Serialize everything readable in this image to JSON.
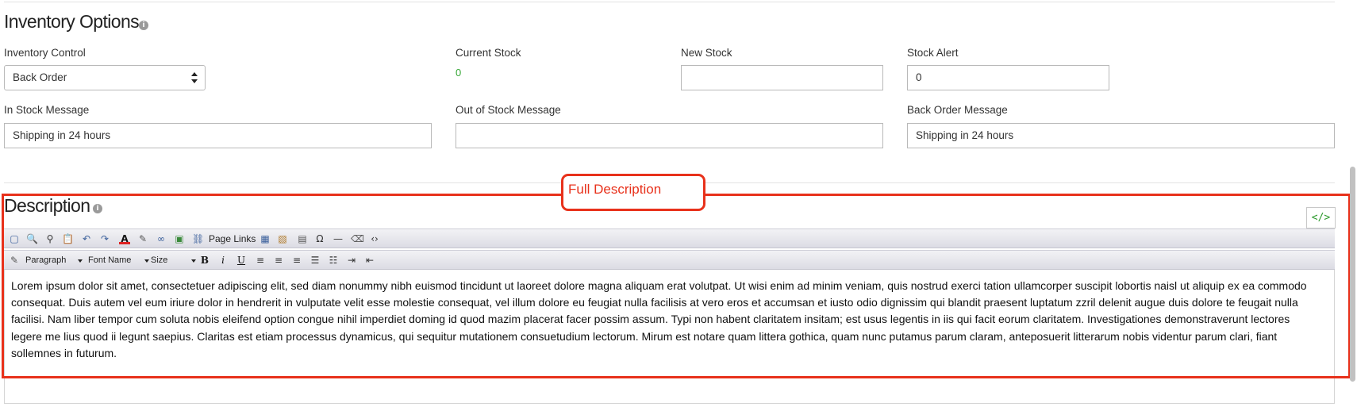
{
  "inventory": {
    "title": "Inventory Options",
    "info_icon": "info-icon",
    "inventory_control": {
      "label": "Inventory Control",
      "value": "Back Order"
    },
    "current_stock": {
      "label": "Current Stock",
      "value": "0"
    },
    "new_stock": {
      "label": "New Stock",
      "value": ""
    },
    "stock_alert": {
      "label": "Stock Alert",
      "value": "0"
    },
    "in_stock_message": {
      "label": "In Stock Message",
      "value": "Shipping in 24 hours"
    },
    "out_of_stock_message": {
      "label": "Out of Stock Message",
      "value": ""
    },
    "back_order_message": {
      "label": "Back Order Message",
      "value": "Shipping in 24 hours"
    }
  },
  "description": {
    "title": "Description",
    "info_icon": "info-icon",
    "callout_label": "Full Description",
    "callout_color": "#e8311b",
    "code_button_label": "</>",
    "toolbar1": {
      "icons": [
        "select-all-icon",
        "find-icon",
        "binoculars-icon",
        "paste-icon",
        "undo-icon",
        "redo-icon",
        "text-color-icon",
        "highlight-icon",
        "link-icon",
        "image-icon",
        "page-link-icon",
        "table-icon",
        "edit-table-icon",
        "form-icon",
        "special-char-icon",
        "horizontal-rule-icon",
        "eraser-icon",
        "source-code-icon"
      ],
      "page_links_label": "Page Links"
    },
    "toolbar2": {
      "paragraph": "Paragraph",
      "font_name": "Font Name",
      "size": "Size",
      "bold": "B",
      "italic": "i",
      "underline": "U"
    },
    "body_text": "Lorem ipsum dolor sit amet, consectetuer adipiscing elit, sed diam nonummy nibh euismod tincidunt ut laoreet dolore magna aliquam erat volutpat. Ut wisi enim ad minim veniam, quis nostrud exerci tation ullamcorper suscipit lobortis naisl ut aliquip ex ea commodo consequat. Duis autem vel eum iriure dolor in hendrerit in vulputate velit esse molestie consequat, vel illum dolore eu feugiat nulla facilisis at vero eros et accumsan et iusto odio dignissim qui blandit praesent luptatum zzril delenit augue duis dolore te feugait nulla facilisi. Nam liber tempor cum soluta nobis eleifend option congue nihil imperdiet doming id quod mazim placerat facer possim assum.  Typi non habent claritatem insitam; est usus legentis in iis qui facit eorum claritatem. Investigationes demonstraverunt lectores legere me lius quod ii legunt saepius. Claritas est etiam processus dynamicus, qui sequitur mutationem consuetudium lectorum. Mirum est notare quam littera gothica, quam nunc putamus parum claram, anteposuerit litterarum nobis videntur parum clari, fiant sollemnes in futurum."
  }
}
